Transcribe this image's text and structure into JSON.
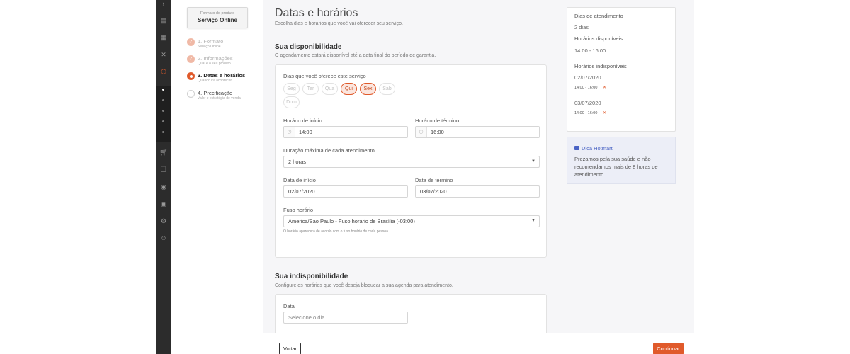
{
  "rail": {
    "items": [
      "chevron-right-icon",
      "dashboard-icon",
      "grid-icon",
      "tools-icon",
      "package-icon",
      "cart-icon",
      "chat-icon",
      "money-icon",
      "chart-icon",
      "settings-icon",
      "support-icon"
    ]
  },
  "product": {
    "format_label": "Formato do produto",
    "format_value": "Serviço Online"
  },
  "steps": [
    {
      "title": "1. Formato",
      "subtitle": "Serviço Online",
      "state": "done"
    },
    {
      "title": "2. Informações",
      "subtitle": "Qual é o seu produto",
      "state": "done"
    },
    {
      "title": "3. Datas e horários",
      "subtitle": "Quando irá acontecer",
      "state": "current"
    },
    {
      "title": "4. Precificação",
      "subtitle": "Valor e estratégia de venda",
      "state": "todo"
    }
  ],
  "main": {
    "title": "Datas e horários",
    "subtitle": "Escolha dias e horários que você vai oferecer seu serviço.",
    "availability": {
      "title": "Sua disponibilidade",
      "subtitle": "O agendamento estará disponível até a data final do período de garantia.",
      "days_label": "Dias que você oferece este serviço",
      "days": [
        {
          "label": "Seg",
          "selected": false
        },
        {
          "label": "Ter",
          "selected": false
        },
        {
          "label": "Qua",
          "selected": false
        },
        {
          "label": "Qui",
          "selected": true
        },
        {
          "label": "Sex",
          "selected": true
        },
        {
          "label": "Sab",
          "selected": false
        },
        {
          "label": "Dom",
          "selected": false
        }
      ],
      "start_time_label": "Horário de início",
      "start_time": "14:00",
      "end_time_label": "Horário de término",
      "end_time": "16:00",
      "duration_label": "Duração máxima de cada atendimento",
      "duration": "2 horas",
      "start_date_label": "Data de início",
      "start_date": "02/07/2020",
      "end_date_label": "Data de término",
      "end_date": "03/07/2020",
      "timezone_label": "Fuso horário",
      "timezone": "America/Sao Paulo - Fuso horário de Brasília (-03:00)",
      "timezone_hint": "O horário aparecerá de acordo com o fuso horário de cada pessoa."
    },
    "unavailability": {
      "title": "Sua indisponibilidade",
      "subtitle": "Configure os horários que você deseja bloquear a sua agenda para atendimento.",
      "date_label": "Data",
      "date_placeholder": "Selecione o dia"
    }
  },
  "summary": {
    "days_heading": "Dias de atendimento",
    "days_value": "2 dias",
    "available_heading": "Horários disponíveis",
    "available_value": "14:00 - 16:00",
    "unavailable_heading": "Horários indisponíveis",
    "unavailable": [
      {
        "date": "02/07/2020",
        "time": "14:00 - 16:00"
      },
      {
        "date": "03/07/2020",
        "time": "14:00 - 16:00"
      }
    ]
  },
  "tip": {
    "title": "Dica Hotmart",
    "body": "Prezamos pela sua saúde e não recomendamos mais de 8 horas de atendimento."
  },
  "footer": {
    "back_label": "Voltar",
    "next_label": "Continuar"
  },
  "colors": {
    "accent": "#e05a2b",
    "rail": "#2c2c2c",
    "tip": "#4a63c4"
  }
}
